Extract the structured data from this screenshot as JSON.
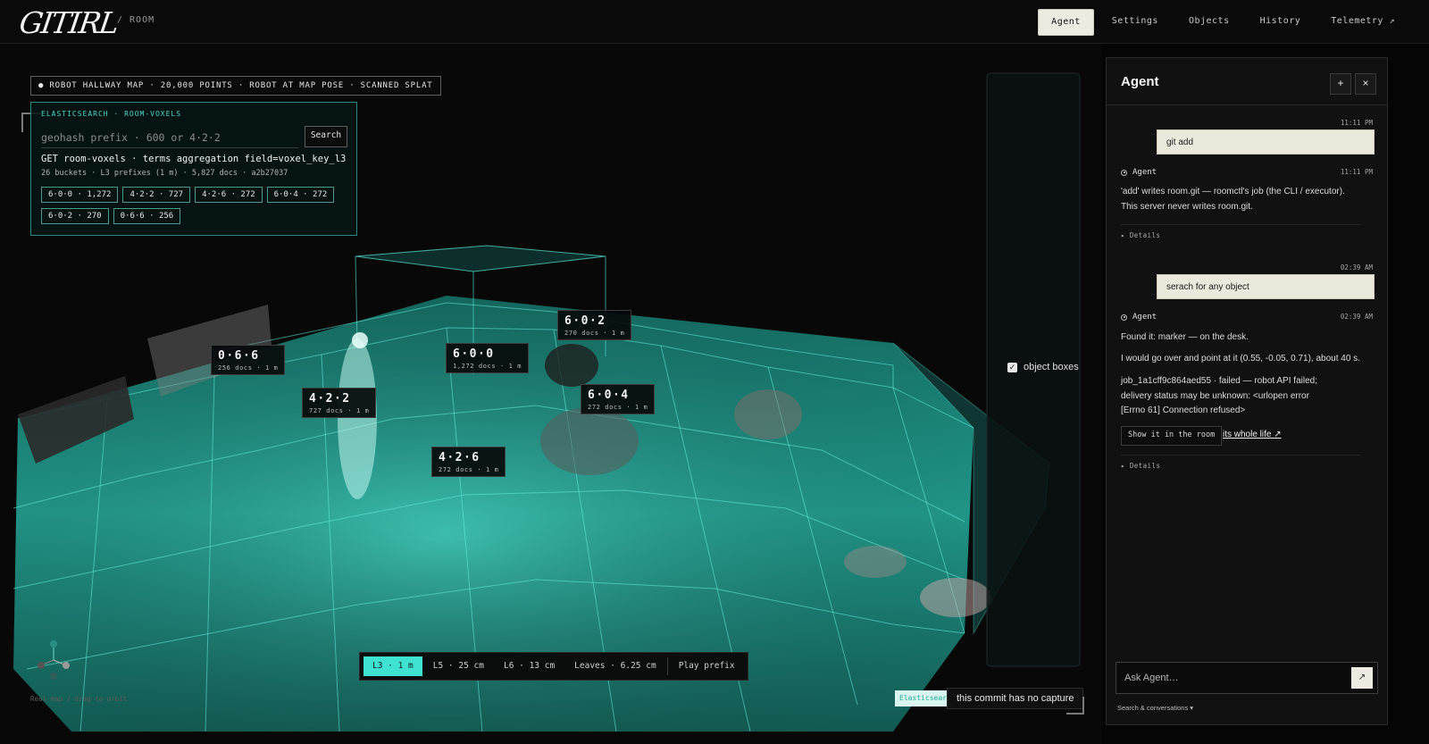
{
  "header": {
    "logo": "GITIRL",
    "breadcrumb": "/ ROOM",
    "tabs": [
      {
        "label": "Agent",
        "active": true
      },
      {
        "label": "Settings",
        "active": false
      },
      {
        "label": "Objects",
        "active": false
      },
      {
        "label": "History",
        "active": false
      },
      {
        "label": "Telemetry ↗",
        "active": false
      }
    ]
  },
  "viewport": {
    "caption": "● ROBOT HALLWAY MAP · 20,000 POINTS · ROBOT AT MAP POSE · SCANNED SPLAT",
    "es_panel": {
      "header": "ELASTICSEARCH · ROOM-VOXELS",
      "placeholder": "geohash prefix · 600 or 4·2·2",
      "search_label": "Search",
      "query": "GET room-voxels · terms aggregation field=voxel_key_l3",
      "meta": "26 buckets · L3 prefixes (1 m) · 5,827 docs · a2b27037",
      "chips": [
        "6·0·0 · 1,272",
        "4·2·2 · 727",
        "4·2·6 · 272",
        "6·0·4 · 272",
        "6·0·2 · 270",
        "0·6·6 · 256"
      ]
    },
    "cell_tags": [
      {
        "key": "0·6·6",
        "sub": "256 docs · 1 m"
      },
      {
        "key": "4·2·2",
        "sub": "727 docs · 1 m"
      },
      {
        "key": "6·0·0",
        "sub": "1,272 docs · 1 m"
      },
      {
        "key": "6·0·2",
        "sub": "270 docs · 1 m"
      },
      {
        "key": "6·0·4",
        "sub": "272 docs · 1 m"
      },
      {
        "key": "4·2·6",
        "sub": "272 docs · 1 m"
      }
    ],
    "object_boxes_label": "object boxes",
    "object_boxes_checked": true,
    "lod_levels": [
      {
        "label": "L3 · 1 m",
        "active": true
      },
      {
        "label": "L5 · 25 cm",
        "active": false
      },
      {
        "label": "L6 · 13 cm",
        "active": false
      },
      {
        "label": "Leaves · 6.25 cm",
        "active": false
      }
    ],
    "play_label": "Play prefix",
    "hint": "Real map / drag to orbit",
    "es_badge": "Elasticsearch",
    "no_capture": "this commit has no capture"
  },
  "agent": {
    "title": "Agent",
    "new_label": "+",
    "close_label": "×",
    "messages": [
      {
        "role": "user",
        "time": "11:11 PM",
        "text": "git add"
      },
      {
        "role": "agent",
        "label": "Agent",
        "time": "11:11 PM",
        "lines": [
          "'add' writes room.git — roomctl's job (the CLI / executor).",
          "This server never writes room.git."
        ],
        "details": "▸ Details"
      },
      {
        "role": "user",
        "time": "02:39 AM",
        "text": "serach for any object"
      },
      {
        "role": "agent",
        "label": "Agent",
        "time": "02:39 AM",
        "lines": [
          "Found it: marker — on the desk.",
          "I would go over and point at it (0.55, -0.05, 0.71), about 40 s.",
          "job_1a1cff9c864aed55 · failed — robot API failed; delivery status may be unknown: <urlopen error [Errno 61] Connection refused>"
        ],
        "show_label": "Show it in the room",
        "life_label": "its whole life ↗",
        "details": "▸ Details"
      }
    ],
    "ask_placeholder": "Ask Agent…",
    "send_icon": "↗",
    "search_conversations": "Search & conversations ▾"
  },
  "colors": {
    "accent": "#3fe1d0",
    "voxel_edge": "#55e6d6",
    "panel_bg": "#111111"
  }
}
